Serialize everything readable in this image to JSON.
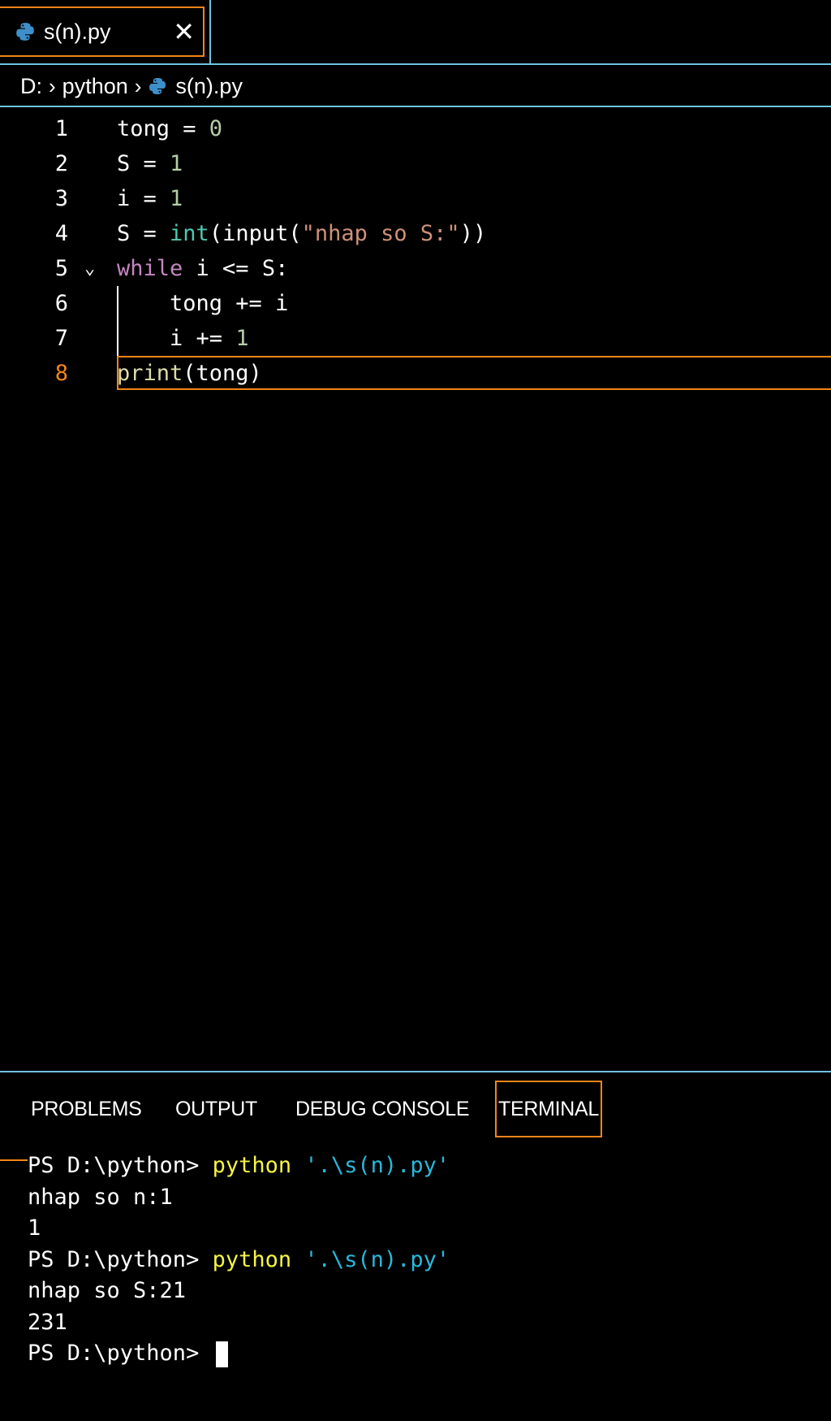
{
  "tab": {
    "label": "s(n).py",
    "close_glyph": "✕",
    "icon": "python-icon"
  },
  "breadcrumb": {
    "drive": "D:",
    "folder": "python",
    "file": "s(n).py"
  },
  "editor": {
    "active_line": 8,
    "lines": [
      {
        "num": "1",
        "tokens": [
          [
            "tong = ",
            "plain"
          ],
          [
            "0",
            "num"
          ]
        ]
      },
      {
        "num": "2",
        "tokens": [
          [
            "S = ",
            "plain"
          ],
          [
            "1",
            "num"
          ]
        ]
      },
      {
        "num": "3",
        "tokens": [
          [
            "i = ",
            "plain"
          ],
          [
            "1",
            "num"
          ]
        ]
      },
      {
        "num": "4",
        "tokens": [
          [
            "S = ",
            "plain"
          ],
          [
            "int",
            "builtin"
          ],
          [
            "(input(",
            "plain"
          ],
          [
            "\"nhap so S:\"",
            "str"
          ],
          [
            "))",
            "plain"
          ]
        ]
      },
      {
        "num": "5",
        "tokens": [
          [
            "while",
            "kw"
          ],
          [
            " i <= S:",
            "plain"
          ]
        ],
        "fold": "⌄"
      },
      {
        "num": "6",
        "tokens": [
          [
            "    tong += i",
            "plain"
          ]
        ]
      },
      {
        "num": "7",
        "tokens": [
          [
            "    i += ",
            "plain"
          ],
          [
            "1",
            "num"
          ]
        ]
      },
      {
        "num": "8",
        "tokens": [
          [
            "print",
            "fn"
          ],
          [
            "(tong)",
            "plain"
          ]
        ]
      }
    ]
  },
  "panel": {
    "tabs": [
      "PROBLEMS",
      "OUTPUT",
      "DEBUG CONSOLE",
      "TERMINAL"
    ],
    "active_tab": "TERMINAL"
  },
  "terminal": {
    "lines": [
      {
        "prompt": "PS D:\\python> ",
        "cmd": "python",
        "arg": " '.\\s(n).py'"
      },
      {
        "text": "nhap so n:1"
      },
      {
        "text": "1"
      },
      {
        "prompt": "PS D:\\python> ",
        "cmd": "python",
        "arg": " '.\\s(n).py'"
      },
      {
        "text": "nhap so S:21"
      },
      {
        "text": "231"
      },
      {
        "prompt": "PS D:\\python> ",
        "cursor": true
      }
    ]
  },
  "colors": {
    "border": "#6fc3df",
    "focus": "#f38518",
    "keyword": "#c586c0",
    "number": "#b5cea8",
    "string": "#ce9178",
    "builtin": "#4ec9b0",
    "function": "#dcdcaa",
    "term_cmd": "#f5f543",
    "term_arg": "#29b8db"
  }
}
